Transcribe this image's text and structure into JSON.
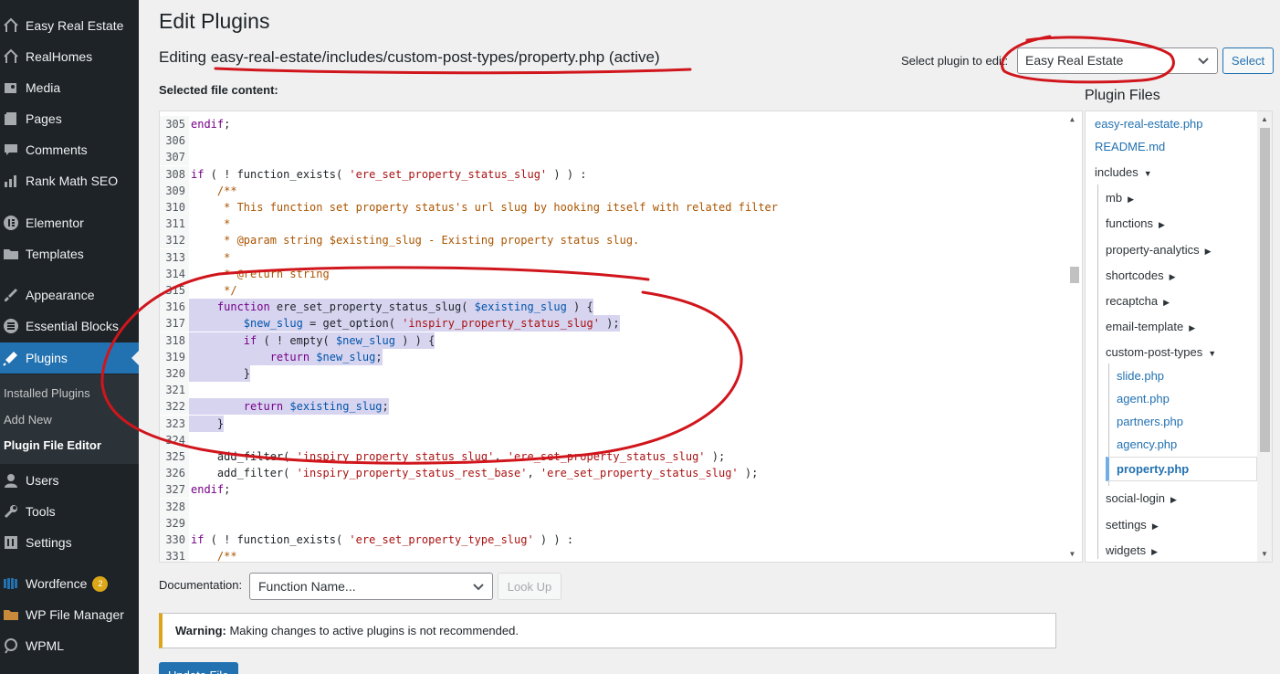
{
  "sidebar": {
    "items": [
      {
        "label": "Easy Real Estate",
        "icon": "house-icon"
      },
      {
        "label": "RealHomes",
        "icon": "house-icon"
      },
      {
        "label": "Media",
        "icon": "media-icon"
      },
      {
        "label": "Pages",
        "icon": "pages-icon"
      },
      {
        "label": "Comments",
        "icon": "comment-icon"
      },
      {
        "label": "Rank Math SEO",
        "icon": "chart-icon"
      },
      {
        "label": "Elementor",
        "icon": "elementor-icon"
      },
      {
        "label": "Templates",
        "icon": "folder-icon"
      },
      {
        "label": "Appearance",
        "icon": "brush-icon"
      },
      {
        "label": "Essential Blocks",
        "icon": "blocks-icon"
      },
      {
        "label": "Plugins",
        "icon": "plugin-icon"
      },
      {
        "label": "Users",
        "icon": "user-icon"
      },
      {
        "label": "Tools",
        "icon": "wrench-icon"
      },
      {
        "label": "Settings",
        "icon": "settings-icon"
      },
      {
        "label": "Wordfence",
        "icon": "shield-icon",
        "badge": "2"
      },
      {
        "label": "WP File Manager",
        "icon": "filemanager-icon"
      },
      {
        "label": "WPML",
        "icon": "wpml-icon"
      }
    ],
    "submenu": [
      "Installed Plugins",
      "Add New",
      "Plugin File Editor"
    ]
  },
  "page": {
    "title": "Edit Plugins",
    "editing_prefix": "Editing ",
    "editing_file": "easy-real-estate/includes/custom-post-types/property.php",
    "editing_status": " (active)",
    "selected_file_label": "Selected file content:",
    "plugin_select_label": "Select plugin to edit:",
    "plugin_select_value": "Easy Real Estate",
    "select_button": "Select"
  },
  "code_lines": [
    {
      "n": "305",
      "text": "endif;"
    },
    {
      "n": "306",
      "text": ""
    },
    {
      "n": "307",
      "text": ""
    },
    {
      "n": "308",
      "text": "if ( ! function_exists( 'ere_set_property_status_slug' ) ) :"
    },
    {
      "n": "309",
      "text": "    /**"
    },
    {
      "n": "310",
      "text": "     * This function set property status's url slug by hooking itself with related filter"
    },
    {
      "n": "311",
      "text": "     *"
    },
    {
      "n": "312",
      "text": "     * @param string $existing_slug - Existing property status slug."
    },
    {
      "n": "313",
      "text": "     *"
    },
    {
      "n": "314",
      "text": "     * @return string"
    },
    {
      "n": "315",
      "text": "     */"
    },
    {
      "n": "316",
      "text": "    function ere_set_property_status_slug( $existing_slug ) {"
    },
    {
      "n": "317",
      "text": "        $new_slug = get_option( 'inspiry_property_status_slug' );"
    },
    {
      "n": "318",
      "text": "        if ( ! empty( $new_slug ) ) {"
    },
    {
      "n": "319",
      "text": "            return $new_slug;"
    },
    {
      "n": "320",
      "text": "        }"
    },
    {
      "n": "321",
      "text": ""
    },
    {
      "n": "322",
      "text": "        return $existing_slug;"
    },
    {
      "n": "323",
      "text": "    }"
    },
    {
      "n": "324",
      "text": ""
    },
    {
      "n": "325",
      "text": "    add_filter( 'inspiry_property_status_slug', 'ere_set_property_status_slug' );"
    },
    {
      "n": "326",
      "text": "    add_filter( 'inspiry_property_status_rest_base', 'ere_set_property_status_slug' );"
    },
    {
      "n": "327",
      "text": "endif;"
    },
    {
      "n": "328",
      "text": ""
    },
    {
      "n": "329",
      "text": ""
    },
    {
      "n": "330",
      "text": "if ( ! function_exists( 'ere_set_property_type_slug' ) ) :"
    },
    {
      "n": "331",
      "text": "    /**"
    }
  ],
  "plugin_files": {
    "title": "Plugin Files",
    "items": [
      {
        "label": "easy-real-estate.php",
        "kind": "file"
      },
      {
        "label": "README.md",
        "kind": "file"
      },
      {
        "label": "includes",
        "kind": "folder-open"
      },
      {
        "label": "mb",
        "kind": "folder"
      },
      {
        "label": "functions",
        "kind": "folder"
      },
      {
        "label": "property-analytics",
        "kind": "folder"
      },
      {
        "label": "shortcodes",
        "kind": "folder"
      },
      {
        "label": "recaptcha",
        "kind": "folder"
      },
      {
        "label": "email-template",
        "kind": "folder"
      },
      {
        "label": "custom-post-types",
        "kind": "folder-open"
      },
      {
        "label": "slide.php",
        "kind": "file"
      },
      {
        "label": "agent.php",
        "kind": "file"
      },
      {
        "label": "partners.php",
        "kind": "file"
      },
      {
        "label": "agency.php",
        "kind": "file"
      },
      {
        "label": "property.php",
        "kind": "current"
      },
      {
        "label": "social-login",
        "kind": "folder"
      },
      {
        "label": "settings",
        "kind": "folder"
      },
      {
        "label": "widgets",
        "kind": "folder"
      }
    ]
  },
  "documentation": {
    "label": "Documentation:",
    "select_value": "Function Name...",
    "lookup_button": "Look Up"
  },
  "warning": {
    "strong": "Warning:",
    "text": " Making changes to active plugins is not recommended."
  },
  "update_button": "Update File",
  "colors": {
    "accent": "#2271b1",
    "sidebar": "#1d2327",
    "annotation": "#d0161c",
    "selection": "#d7d4f0"
  }
}
